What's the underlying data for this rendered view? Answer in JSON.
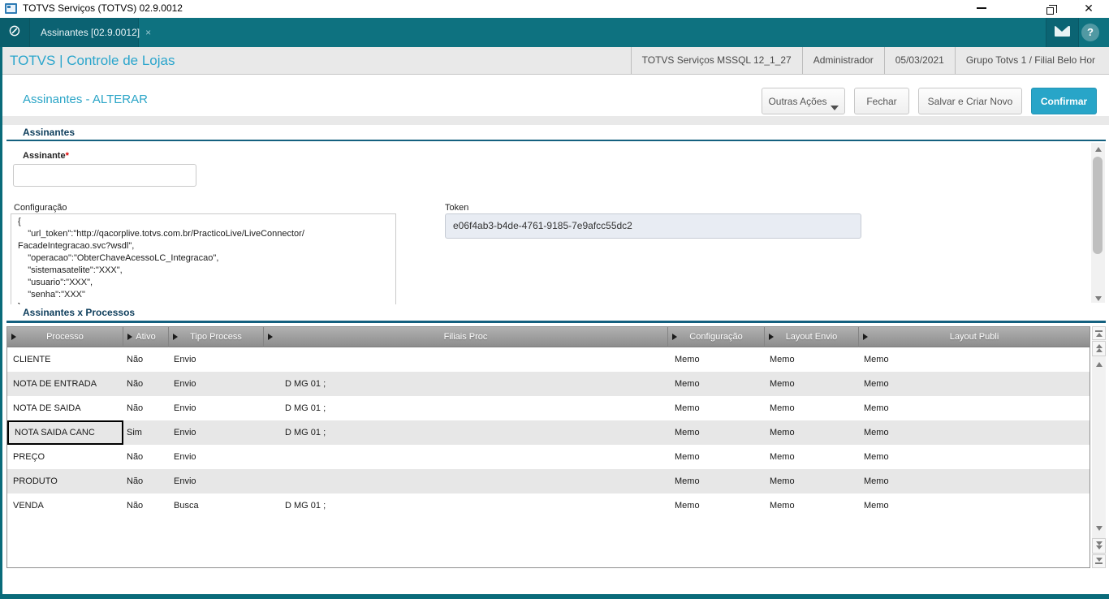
{
  "window": {
    "title": "TOTVS Serviços (TOTVS) 02.9.0012"
  },
  "tabbar": {
    "tab": {
      "label": "Assinantes [02.9.0012]"
    }
  },
  "header": {
    "brand": "TOTVS | Controle de Lojas",
    "info": [
      "TOTVS Serviços MSSQL 12_1_27",
      "Administrador",
      "05/03/2021",
      "Grupo Totvs 1 / Filial Belo Hor"
    ]
  },
  "page": {
    "title": "Assinantes - ALTERAR",
    "buttons": {
      "other_actions": "Outras Ações",
      "close": "Fechar",
      "save_new": "Salvar e Criar Novo",
      "confirm": "Confirmar"
    }
  },
  "form": {
    "section_title": "Assinantes",
    "assinante": {
      "label": "Assinante",
      "required_mark": "*",
      "value": ""
    },
    "configuracao": {
      "label": "Configuração",
      "value": "{\n    \"url_token\":\"http://qacorplive.totvs.com.br/PracticoLive/LiveConnector/\nFacadeIntegracao.svc?wsdl\",\n    \"operacao\":\"ObterChaveAcessoLC_Integracao\",\n    \"sistemasatelite\":\"XXX\",\n    \"usuario\":\"XXX\",\n    \"senha\":\"XXX\"\n}"
    },
    "token": {
      "label": "Token",
      "value": "e06f4ab3-b4de-4761-9185-7e9afcc55dc2"
    }
  },
  "grid": {
    "section_title": "Assinantes x Processos",
    "columns": [
      "Processo",
      "Ativo",
      "Tipo Process",
      "Filiais Proc",
      "Configuração",
      "Layout Envio",
      "Layout Publi"
    ],
    "rows": [
      [
        "CLIENTE",
        "Não",
        "Envio",
        "",
        "Memo",
        "Memo",
        "Memo"
      ],
      [
        "NOTA DE ENTRADA",
        "Não",
        "Envio",
        "D MG 01 ;",
        "Memo",
        "Memo",
        "Memo"
      ],
      [
        "NOTA DE SAIDA",
        "Não",
        "Envio",
        "D MG 01 ;",
        "Memo",
        "Memo",
        "Memo"
      ],
      [
        "NOTA SAIDA CANC",
        "Sim",
        "Envio",
        "D MG 01 ;",
        "Memo",
        "Memo",
        "Memo"
      ],
      [
        "PREÇO",
        "Não",
        "Envio",
        "",
        "Memo",
        "Memo",
        "Memo"
      ],
      [
        "PRODUTO",
        "Não",
        "Envio",
        "",
        "Memo",
        "Memo",
        "Memo"
      ],
      [
        "VENDA",
        "Não",
        "Busca",
        "D MG 01 ;",
        "Memo",
        "Memo",
        "Memo"
      ]
    ],
    "selected": {
      "row": 3,
      "col": 0
    }
  },
  "colors": {
    "teal_bar": "#0e7280",
    "teal_edge": "#0a6b7a",
    "accent_cyan": "#28a5c8",
    "section_blue": "#14607f",
    "row_alt": "#e7e7e7"
  }
}
